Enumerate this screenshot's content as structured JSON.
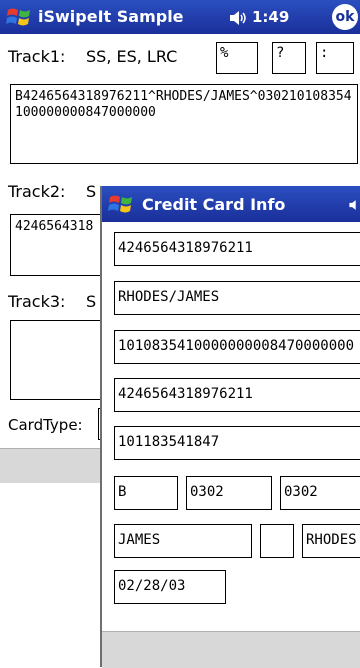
{
  "main_window": {
    "title": "iSwipeIt Sample",
    "clock": "1:49",
    "ok_label": "ok",
    "track1_label": "Track1:",
    "track1_sentinels_label": "SS, ES, LRC",
    "track1_ss": "%",
    "track1_es": "?",
    "track1_lrc": ":",
    "track1_data": "B4246564318976211^RHODES/JAMES^030210108354100000000847000000",
    "track2_label": "Track2:",
    "track2_partial_label": "S",
    "track2_data": "4246564318",
    "track3_label": "Track3:",
    "track3_partial_label": "S",
    "track3_data": "",
    "cardtype_label": "CardType:"
  },
  "card_dialog": {
    "title": "Credit Card Info",
    "card_number": "4246564318976211",
    "name_raw": "RHODES/JAMES",
    "discretionary": "1010835410000000008470000000",
    "card_number_2": "4246564318976211",
    "field_5": "101183541847",
    "format_code": "B",
    "exp_1": "0302",
    "exp_2": "0302",
    "first_name": "JAMES",
    "middle_initial": "",
    "last_name": "RHODES",
    "exp_date": "02/28/03"
  },
  "colors": {
    "titlebar": "#1a2f9a",
    "command_bar": "#d8d8d8"
  },
  "icons": {
    "start": "windows-flag-icon",
    "volume": "speaker-icon",
    "ok": "ok-button-icon"
  }
}
